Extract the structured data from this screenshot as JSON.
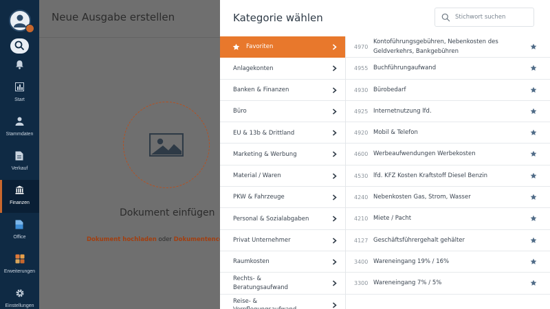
{
  "nav": {
    "items": [
      {
        "label": "Start",
        "icon": "chart-icon"
      },
      {
        "label": "Stammdaten",
        "icon": "person-icon"
      },
      {
        "label": "Verkauf",
        "icon": "document-icon"
      },
      {
        "label": "Finanzen",
        "icon": "bank-icon",
        "active": true
      },
      {
        "label": "Office",
        "icon": "office-icon"
      },
      {
        "label": "Erweiterungen",
        "icon": "grid-icon"
      },
      {
        "label": "Einstellungen",
        "icon": "gear-icon"
      }
    ]
  },
  "page": {
    "title": "Neue Ausgabe erstellen",
    "drop_title": "Dokument einfügen",
    "upload_link": "Dokument hochladen",
    "or_text": " oder ",
    "container_link": "Dokumentencontai"
  },
  "panel": {
    "title": "Kategorie wählen",
    "search_placeholder": "Stichwort suchen",
    "categories": [
      "Favoriten",
      "Anlagekonten",
      "Banken & Finanzen",
      "Büro",
      "EU & 13b & Drittland",
      "Marketing & Werbung",
      "Material / Waren",
      "PKW & Fahrzeuge",
      "Personal & Sozialabgaben",
      "Privat Unternehmer",
      "Raumkosten",
      "Rechts- & Beratungsaufwand",
      "Reise- & Verpflegungsaufwand"
    ],
    "accounts": [
      {
        "number": "4970",
        "name": "Kontoführungsgebühren, Nebenkosten des Geldverkehrs, Bankgebühren"
      },
      {
        "number": "4955",
        "name": "Buchführungaufwand"
      },
      {
        "number": "4930",
        "name": "Bürobedarf"
      },
      {
        "number": "4925",
        "name": "Internetnutzung lfd."
      },
      {
        "number": "4920",
        "name": "Mobil & Telefon"
      },
      {
        "number": "4600",
        "name": "Werbeaufwendungen Werbekosten"
      },
      {
        "number": "4530",
        "name": "lfd. KFZ Kosten Kraftstoff Diesel Benzin"
      },
      {
        "number": "4240",
        "name": "Nebenkosten Gas, Strom, Wasser"
      },
      {
        "number": "4210",
        "name": "Miete / Pacht"
      },
      {
        "number": "4127",
        "name": "Geschäftsführergehalt gehälter"
      },
      {
        "number": "3400",
        "name": "Wareneingang 19% / 16%"
      },
      {
        "number": "3300",
        "name": "Wareneingang 7% / 5%"
      }
    ]
  },
  "colors": {
    "accent": "#e8782c",
    "nav_bg": "#0f2a44",
    "star": "#4f6b87"
  }
}
